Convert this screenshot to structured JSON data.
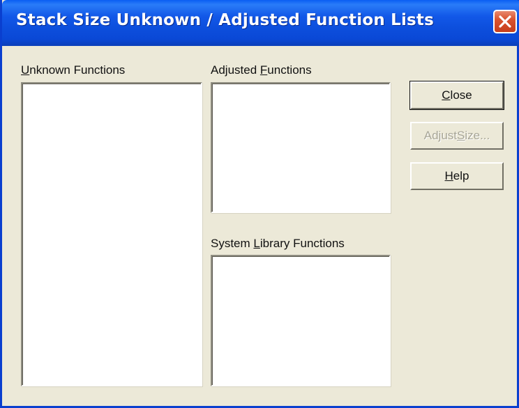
{
  "window": {
    "title": "Stack Size Unknown / Adjusted Function Lists"
  },
  "lists": {
    "unknown": {
      "label_mnemonic": "U",
      "label_rest": "nknown Functions",
      "items": []
    },
    "adjusted": {
      "label_pre": "Adjusted ",
      "label_mnemonic": "F",
      "label_post": "unctions",
      "items": []
    },
    "system": {
      "label_pre": "System ",
      "label_mnemonic": "L",
      "label_post": "ibrary Functions",
      "items": []
    }
  },
  "buttons": {
    "close": {
      "mnemonic": "C",
      "rest": "lose",
      "enabled": true
    },
    "adjust": {
      "pre": "Adjust ",
      "mnemonic": "S",
      "post": "ize...",
      "enabled": false
    },
    "help": {
      "mnemonic": "H",
      "rest": "elp",
      "enabled": true
    }
  },
  "colors": {
    "titlebar": "#0A4FDD",
    "dialog_bg": "#ECE9D8",
    "close_button": "#D9532F"
  },
  "icons": {
    "close": "close-x-icon"
  }
}
